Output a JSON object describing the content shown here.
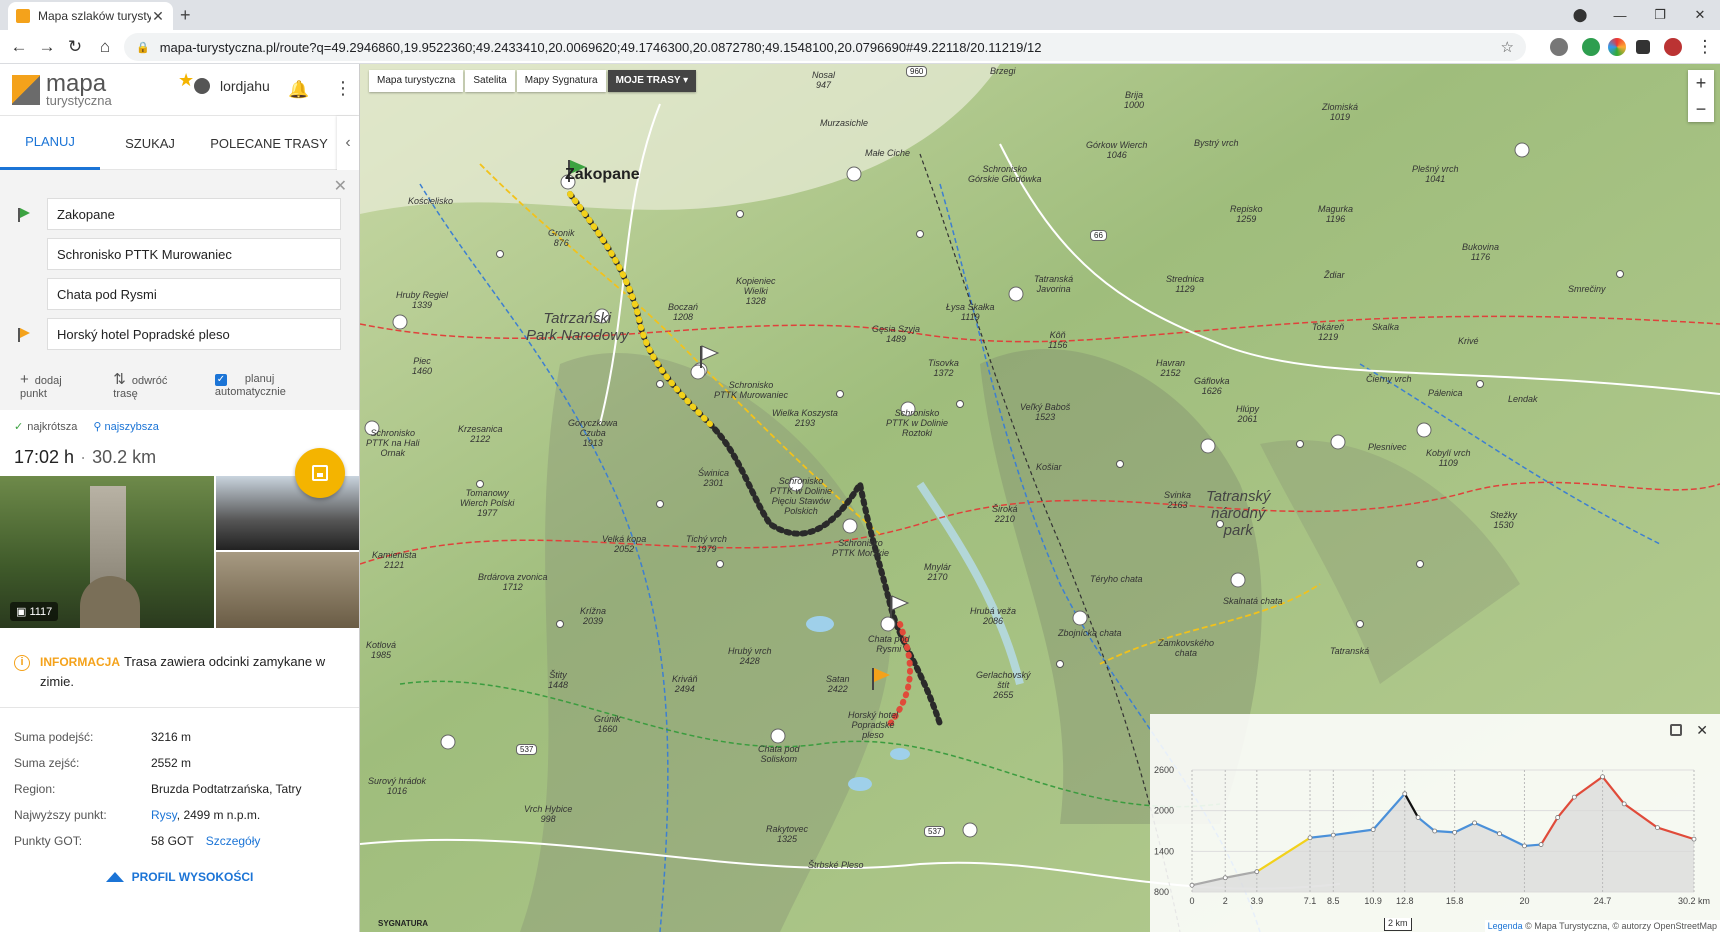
{
  "browser": {
    "tab_title": "Mapa szlaków turystycz",
    "url": "mapa-turystyczna.pl/route?q=49.2946860,19.9522360;49.2433410,20.0069620;49.1746300,20.0872780;49.1548100,20.0796690#49.22118/20.11219/12"
  },
  "header": {
    "logo_line1": "mapa",
    "logo_line2": "turystyczna",
    "username": "lordjahu"
  },
  "tabs": [
    {
      "label": "PLANUJ"
    },
    {
      "label": "SZUKAJ"
    },
    {
      "label": "POLECANE TRASY"
    }
  ],
  "planner": {
    "waypoints": [
      {
        "value": "Zakopane",
        "flag": "#3ca341"
      },
      {
        "value": "Schronisko PTTK Murowaniec",
        "flag": ""
      },
      {
        "value": "Chata pod Rysmi",
        "flag": ""
      },
      {
        "value": "Horský hotel Popradské pleso",
        "flag": "#f4a21b"
      }
    ],
    "add_point": "dodaj punkt",
    "reverse": "odwróć trasę",
    "auto_plan": "planuj automatycznie"
  },
  "result": {
    "mode_shortest": "najkrótsza",
    "mode_fastest": "najszybsza",
    "time": "17:02 h",
    "separator": "·",
    "distance": "30.2 km",
    "photo_count": "1117"
  },
  "info": {
    "label": "INFORMACJA",
    "text": "Trasa zawiera odcinki zamykane w zimie."
  },
  "stats": [
    {
      "key": "Suma podejść:",
      "value": "3216 m"
    },
    {
      "key": "Suma zejść:",
      "value": "2552 m"
    },
    {
      "key": "Region:",
      "value": "Bruzda Podtatrzańska, Tatry"
    },
    {
      "key": "Najwyższy punkt:",
      "link": "Rysy",
      "value": ", 2499 m n.p.m."
    },
    {
      "key": "Punkty GOT:",
      "value": "58 GOT",
      "extra_link": "Szczegóły"
    }
  ],
  "profile_button": "PROFIL WYSOKOŚCI",
  "map": {
    "types": [
      "Mapa turystyczna",
      "Satelita",
      "Mapy Sygnatura",
      "MOJE TRASY"
    ],
    "zoom_in": "+",
    "zoom_out": "−",
    "labels": [
      {
        "t": "Zakopane",
        "c": "big"
      },
      {
        "t": "Tatrzański\nPark Narodowy",
        "c": "park"
      },
      {
        "t": "Tatranský\nnárodný\npark",
        "c": "park"
      },
      {
        "t": "Kościelisko"
      },
      {
        "t": "Brzegi"
      },
      {
        "t": "Murzasichle"
      },
      {
        "t": "Małe Ciche"
      },
      {
        "t": "Schronisko\nGórskie Głodówka"
      },
      {
        "t": "Gronik\n876"
      },
      {
        "t": "Kopieniec\nWielki\n1328"
      },
      {
        "t": "Boczań\n1208"
      },
      {
        "t": "Schronisko\nPTTK Murowaniec"
      },
      {
        "t": "Gęsia Szyja\n1489"
      },
      {
        "t": "Łysa Skałka\n1119"
      },
      {
        "t": "Tatranská\nJavorina"
      },
      {
        "t": "Nosal\n947"
      },
      {
        "t": "Brija\n1000"
      },
      {
        "t": "Zlomiská\n1019"
      },
      {
        "t": "Bystrý vrch"
      },
      {
        "t": "Górkow Wierch\n1046"
      },
      {
        "t": "Magurka\n1196"
      },
      {
        "t": "Plešný vrch\n1041"
      },
      {
        "t": "Bukovina\n1176"
      },
      {
        "t": "Repisko\n1259"
      },
      {
        "t": "Strednica\n1129"
      },
      {
        "t": "Ždiar"
      },
      {
        "t": "Smrečiny"
      },
      {
        "t": "Hruby Regiel\n1339"
      },
      {
        "t": "Piec\n1460"
      },
      {
        "t": "Tisovka\n1372"
      },
      {
        "t": "Kôň\n1156"
      },
      {
        "t": "Havran\n2152"
      },
      {
        "t": "Tokáreň\n1219"
      },
      {
        "t": "Skalka"
      },
      {
        "t": "Krivé"
      },
      {
        "t": "Gáflovka\n1626"
      },
      {
        "t": "Čierny vrch"
      },
      {
        "t": "Pálenica"
      },
      {
        "t": "Lendak"
      },
      {
        "t": "Hlúpy\n2061"
      },
      {
        "t": "Veľký Baboš\n1523"
      },
      {
        "t": "Wielka Koszysta\n2193"
      },
      {
        "t": "Schronisko\nPTTK w Dolinie\nRoztoki"
      },
      {
        "t": "Krzesanica\n2122"
      },
      {
        "t": "Goryczkowa\nCzuba\n1913"
      },
      {
        "t": "Świnica\n2301"
      },
      {
        "t": "Schronisko\nPTTK w Dolinie\nPięciu Stawów\nPolskich"
      },
      {
        "t": "Schronisko\nPTTK Morskie"
      },
      {
        "t": "Košiar"
      },
      {
        "t": "Široká\n2210"
      },
      {
        "t": "Svinka\n2163"
      },
      {
        "t": "Plesnivec"
      },
      {
        "t": "Kobylí vrch\n1109"
      },
      {
        "t": "Stežky\n1530"
      },
      {
        "t": "Schronisko\nPTTK na Hali\nOrnak"
      },
      {
        "t": "Tomanowy\nWierch Polski\n1977"
      },
      {
        "t": "Kamienista\n2121"
      },
      {
        "t": "Velká kopa\n2052"
      },
      {
        "t": "Tichý vrch\n1979"
      },
      {
        "t": "Mnylár\n2170"
      },
      {
        "t": "Téryho chata"
      },
      {
        "t": "Skalnatá chata"
      },
      {
        "t": "Brdárova zvonica\n1712"
      },
      {
        "t": "Krížna\n2039"
      },
      {
        "t": "Hrubá veža\n2086"
      },
      {
        "t": "Zbojnícka chata"
      },
      {
        "t": "Zamkovského\nchata"
      },
      {
        "t": "Chata pod\nRysmi"
      },
      {
        "t": "Kotlová\n1985"
      },
      {
        "t": "Štity\n1448"
      },
      {
        "t": "Kriváň\n2494"
      },
      {
        "t": "Hrubý vrch\n2428"
      },
      {
        "t": "Satan\n2422"
      },
      {
        "t": "Horský hotel\nPopradské\npleso"
      },
      {
        "t": "Gerlachovský\nštít\n2655"
      },
      {
        "t": "Grúnik\n1660"
      },
      {
        "t": "Chata pod\nSoliskom"
      },
      {
        "t": "Surový hrádok\n1016"
      },
      {
        "t": "Vrch Hybice\n998"
      },
      {
        "t": "Rakytovec\n1325"
      },
      {
        "t": "Štrbské Pleso"
      },
      {
        "t": "Tatranská"
      }
    ],
    "road_numbers": [
      "960",
      "66",
      "537",
      "537"
    ],
    "signatura": "SYGNATURA"
  },
  "elevation": {
    "y_ticks": [
      "2600",
      "2000",
      "1400",
      "800"
    ],
    "x_ticks": [
      "0",
      "2",
      "3.9",
      "7.1",
      "8.5",
      "10.9",
      "12.8",
      "15.8",
      "20",
      "24.7",
      "30.2 km"
    ],
    "scale": "2 km",
    "legend": "Legenda",
    "attribution": " © Mapa Turystyczna, © autorzy OpenStreetMap"
  },
  "chart_data": {
    "type": "area",
    "x": [
      0,
      2,
      3.9,
      7.1,
      8.5,
      10.9,
      12.8,
      13.6,
      14.6,
      15.8,
      17,
      18.5,
      20,
      21,
      22,
      23,
      24.7,
      26,
      28,
      30.2
    ],
    "values": [
      900,
      1010,
      1100,
      1600,
      1640,
      1720,
      2250,
      1900,
      1700,
      1680,
      1820,
      1660,
      1480,
      1500,
      1900,
      2200,
      2500,
      2100,
      1750,
      1580
    ],
    "ylim": [
      800,
      2600
    ],
    "xlim": [
      0,
      30.2
    ],
    "y_ticks": [
      2600,
      2000,
      1400,
      800
    ],
    "colors": {
      "low": "#aaaaaa",
      "climb": "#f2d11b",
      "mid": "#4a90d9",
      "steep": "#111111",
      "high": "#e04b3a"
    }
  }
}
